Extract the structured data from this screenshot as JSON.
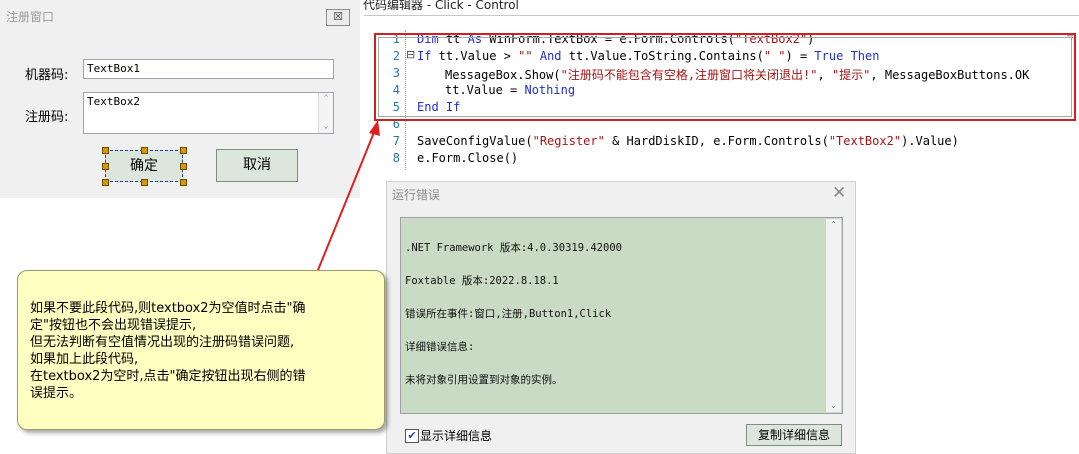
{
  "register_dialog": {
    "title": "注册窗口",
    "close": "☒",
    "machine_label": "机器码:",
    "machine_value": "TextBox1",
    "reg_label": "注册码:",
    "reg_value": "TextBox2",
    "ok_label": "确定",
    "cancel_label": "取消"
  },
  "editor": {
    "title": "代码编辑器 - Click - Control",
    "lines": [
      {
        "num": "1",
        "text": "Dim tt As WinForm.TextBox = e.Form.Controls(\"TextBox2\")"
      },
      {
        "num": "2",
        "text": "If tt.Value > \"\" And tt.Value.ToString.Contains(\" \") = True Then"
      },
      {
        "num": "3",
        "text": "MessageBox.Show(\"注册码不能包含有空格,注册窗口将关闭退出!\", \"提示\", MessageBoxButtons.OK"
      },
      {
        "num": "4",
        "text": "tt.Value = Nothing"
      },
      {
        "num": "5",
        "text": "End If"
      },
      {
        "num": "6",
        "text": ""
      },
      {
        "num": "7",
        "text": "SaveConfigValue(\"Register\" & HardDiskID, e.Form.Controls(\"TextBox2\").Value)"
      },
      {
        "num": "8",
        "text": "e.Form.Close()"
      }
    ],
    "fold_marker": "⊟"
  },
  "error_dialog": {
    "title": "运行错误",
    "close": "✕",
    "lines": [
      ".NET Framework 版本:4.0.30319.42000",
      "Foxtable 版本:2022.8.18.1",
      "错误所在事件:窗口,注册,Button1,Click",
      "详细错误信息:",
      "未将对象引用设置到对象的实例。"
    ],
    "checkbox_label": "显示详细信息",
    "checkbox_checked": "✔",
    "copy_button": "复制详细信息"
  },
  "callout": {
    "lines": [
      "如果不要此段代码,则textbox2为空值时点击\"确",
      "定\"按钮也不会出现错误提示,",
      "但无法判断有空值情况出现的注册码错误问题,",
      "如果加上此段代码,",
      "在textbox2为空时,点击\"确定按钮出现右侧的错",
      "误提示。"
    ]
  },
  "colors": {
    "annotation_red": "#e02020",
    "callout_bg": "#ffffc2",
    "error_bg": "#c9dbc5",
    "keyword": "#1f2fd0",
    "string": "#a31515"
  }
}
